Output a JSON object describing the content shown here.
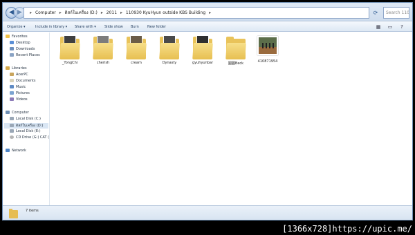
{
  "address": {
    "crumbs": [
      "Computer",
      "ดิสก์ในเครื่อง (D:)",
      "2011",
      "110930 KyuHyun outside KBS Building"
    ],
    "search_placeholder": "Search 110..."
  },
  "toolbar": {
    "organize": "Organize ▾",
    "include": "Include in library ▾",
    "share": "Share with ▾",
    "slideshow": "Slide show",
    "burn": "Burn",
    "newfolder": "New folder"
  },
  "nav": {
    "favorites": "Favorites",
    "desktop": "Desktop",
    "downloads": "Downloads",
    "recent": "Recent Places",
    "libraries": "Libraries",
    "acerpc": "AcerPC",
    "documents": "Documents",
    "music": "Music",
    "pictures": "Pictures",
    "videos": "Videos",
    "computer": "Computer",
    "diskc": "Local Disk (C:)",
    "diskd": "ดิสก์ในเครื่อง (D:)",
    "diske": "Local Disk (E:)",
    "cdrom": "CD Drive (G:) CAT (",
    "network": "Network"
  },
  "items": [
    {
      "label": "_YongChi"
    },
    {
      "label": "cherish"
    },
    {
      "label": "cream"
    },
    {
      "label": "Dynasty"
    },
    {
      "label": "gyuhyunbar"
    },
    {
      "label": "圓圓Beck"
    },
    {
      "label": "410871954"
    }
  ],
  "details": {
    "count": "7 items"
  },
  "watermark": "[1366x728]https://upic.me/",
  "colors": {
    "folder": "#e9c35a",
    "accent": "#2e5a91"
  }
}
